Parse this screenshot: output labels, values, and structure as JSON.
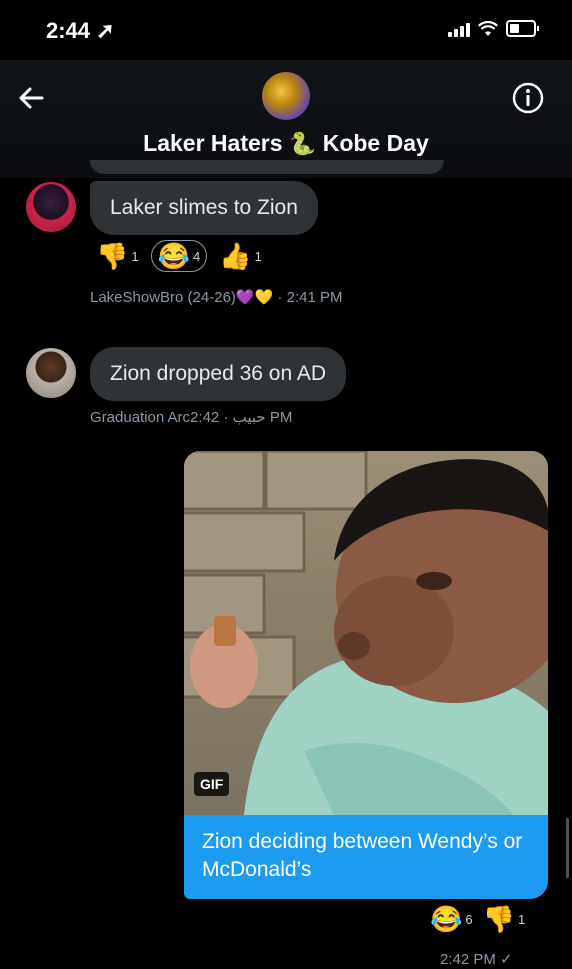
{
  "status_bar": {
    "time": "2:44"
  },
  "header": {
    "title": "Laker Haters",
    "title_emoji": "🐍",
    "title_suffix": "Kobe Day"
  },
  "messages": [
    {
      "text": "Laker slimes to Zion",
      "reactions": [
        {
          "emoji": "👎",
          "count": "1"
        },
        {
          "emoji": "😂",
          "count": "4",
          "selected": true
        },
        {
          "emoji": "👍",
          "count": "1"
        }
      ],
      "sender": "LakeShowBro (24-26)",
      "sender_emojis": "💜💛",
      "time": "· 2:41 PM"
    },
    {
      "text": "Zion dropped 36 on AD",
      "sender": "Graduation Arcحبيب",
      "time": "· 2:42 PM"
    },
    {
      "gif_badge": "GIF",
      "caption": "Zion deciding between Wendy’s or McDonald’s",
      "reactions": [
        {
          "emoji": "😂",
          "count": "6"
        },
        {
          "emoji": "👎",
          "count": "1"
        }
      ],
      "time": "2:42 PM",
      "status": "✓"
    }
  ],
  "colors": {
    "accent": "#1d9bf0",
    "bubble": "#2f3336",
    "meta": "#8b98a5"
  }
}
